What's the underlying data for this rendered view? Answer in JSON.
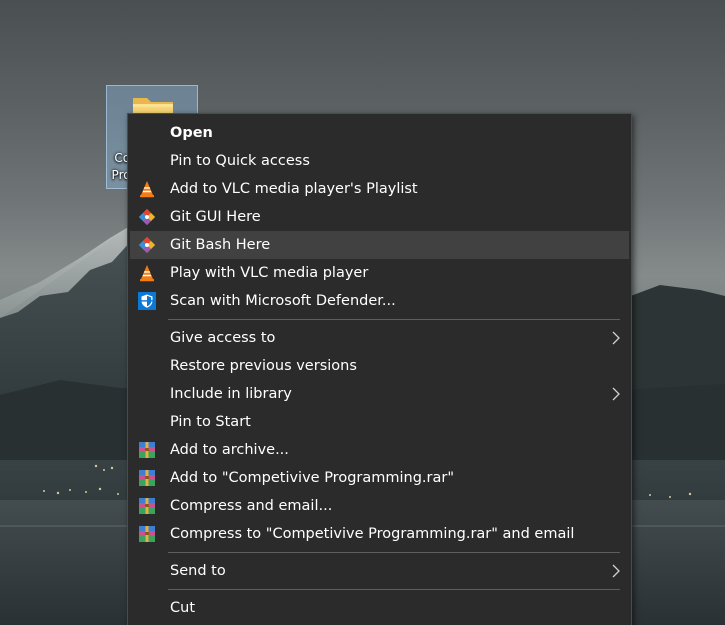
{
  "desktop": {
    "folder_label": "Competivive Programming"
  },
  "context_menu": {
    "groups": [
      {
        "items": [
          {
            "label": "Open",
            "icon": "",
            "bold": true
          },
          {
            "label": "Pin to Quick access",
            "icon": ""
          },
          {
            "label": "Add to VLC media player's Playlist",
            "icon": "vlc-icon"
          },
          {
            "label": "Git GUI Here",
            "icon": "git-icon"
          },
          {
            "label": "Git Bash Here",
            "icon": "git-icon",
            "highlighted": true
          },
          {
            "label": "Play with VLC media player",
            "icon": "vlc-icon"
          },
          {
            "label": "Scan with Microsoft Defender...",
            "icon": "defender-shield-icon"
          }
        ]
      },
      {
        "items": [
          {
            "label": "Give access to",
            "icon": "",
            "submenu": true
          },
          {
            "label": "Restore previous versions",
            "icon": ""
          },
          {
            "label": "Include in library",
            "icon": "",
            "submenu": true
          },
          {
            "label": "Pin to Start",
            "icon": ""
          },
          {
            "label": "Add to archive...",
            "icon": "winrar-icon"
          },
          {
            "label": "Add to \"Competivive Programming.rar\"",
            "icon": "winrar-icon"
          },
          {
            "label": "Compress and email...",
            "icon": "winrar-icon"
          },
          {
            "label": "Compress to \"Competivive Programming.rar\" and email",
            "icon": "winrar-icon"
          }
        ]
      },
      {
        "items": [
          {
            "label": "Send to",
            "icon": "",
            "submenu": true
          }
        ]
      },
      {
        "items": [
          {
            "label": "Cut",
            "icon": ""
          }
        ]
      }
    ]
  }
}
